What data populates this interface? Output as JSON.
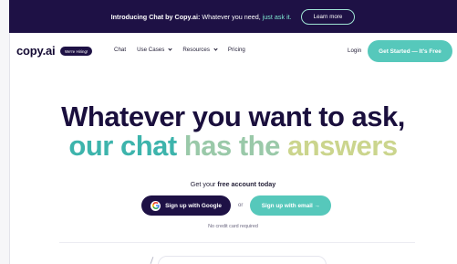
{
  "announcement": {
    "prefix": "Introducing Chat by Copy.ai:",
    "middle": " Whatever you need, ",
    "accent": "just ask it.",
    "button": "Learn more"
  },
  "nav": {
    "logo": "copy.ai",
    "hiring_badge": "We're Hiring!",
    "links": [
      "Chat",
      "Use Cases",
      "Resources",
      "Pricing"
    ],
    "login": "Login",
    "cta": "Get Started — It's Free"
  },
  "hero": {
    "line1": "Whatever you want to ask,",
    "line2_part1": "our chat ",
    "line2_part2": "has the ",
    "line2_part3": "answers"
  },
  "signup": {
    "prompt_prefix": "Get your ",
    "prompt_bold": "free account today",
    "google_button": "Sign up with Google",
    "or": "or",
    "email_button": "Sign up with email →",
    "note": "No credit card required"
  },
  "colors": {
    "dark": "#1e1145",
    "teal": "#56c8bb"
  }
}
